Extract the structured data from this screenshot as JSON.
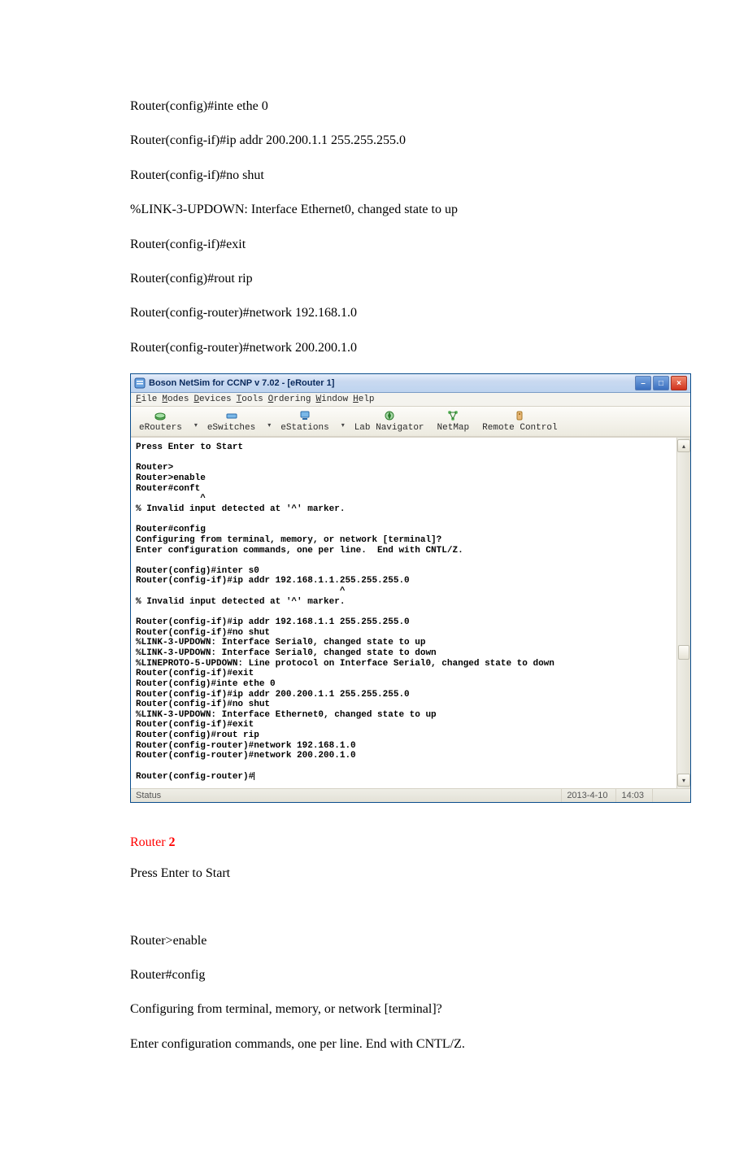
{
  "doc": {
    "lines_top": [
      "Router(config)#inte ethe 0",
      "Router(config-if)#ip addr 200.200.1.1 255.255.255.0",
      "Router(config-if)#no shut",
      "%LINK-3-UPDOWN: Interface Ethernet0, changed state to up",
      "Router(config-if)#exit",
      "Router(config)#rout rip",
      "Router(config-router)#network 192.168.1.0",
      "Router(config-router)#network 200.200.1.0"
    ],
    "router2_label": "Router ",
    "router2_num": "2",
    "lines_bottom": [
      "Press Enter to Start",
      "",
      "Router>enable",
      "Router#config",
      "Configuring from terminal, memory, or network [terminal]?",
      "Enter configuration commands, one per line.    End with CNTL/Z."
    ]
  },
  "app": {
    "title": "Boson NetSim for CCNP v 7.02 - [eRouter 1]",
    "menu": [
      "File",
      "Modes",
      "Devices",
      "Tools",
      "Ordering",
      "Window",
      "Help"
    ],
    "toolbar": [
      {
        "label": "eRouters",
        "dropdown": true
      },
      {
        "label": "eSwitches",
        "dropdown": true
      },
      {
        "label": "eStations",
        "dropdown": true
      },
      {
        "label": "Lab Navigator",
        "dropdown": false
      },
      {
        "label": "NetMap",
        "dropdown": false
      },
      {
        "label": "Remote Control",
        "dropdown": false
      }
    ],
    "terminal_text": "Press Enter to Start\n\nRouter>\nRouter>enable\nRouter#conft\n            ^\n% Invalid input detected at '^' marker.\n\nRouter#config\nConfiguring from terminal, memory, or network [terminal]?\nEnter configuration commands, one per line.  End with CNTL/Z.\n\nRouter(config)#inter s0\nRouter(config-if)#ip addr 192.168.1.1.255.255.255.0\n                                      ^\n% Invalid input detected at '^' marker.\n\nRouter(config-if)#ip addr 192.168.1.1 255.255.255.0\nRouter(config-if)#no shut\n%LINK-3-UPDOWN: Interface Serial0, changed state to up\n%LINK-3-UPDOWN: Interface Serial0, changed state to down\n%LINEPROTO-5-UPDOWN: Line protocol on Interface Serial0, changed state to down\nRouter(config-if)#exit\nRouter(config)#inte ethe 0\nRouter(config-if)#ip addr 200.200.1.1 255.255.255.0\nRouter(config-if)#no shut\n%LINK-3-UPDOWN: Interface Ethernet0, changed state to up\nRouter(config-if)#exit\nRouter(config)#rout rip\nRouter(config-router)#network 192.168.1.0\nRouter(config-router)#network 200.200.1.0\n\nRouter(config-router)#",
    "status": {
      "label": "Status",
      "date": "2013-4-10",
      "time": "14:03"
    }
  }
}
